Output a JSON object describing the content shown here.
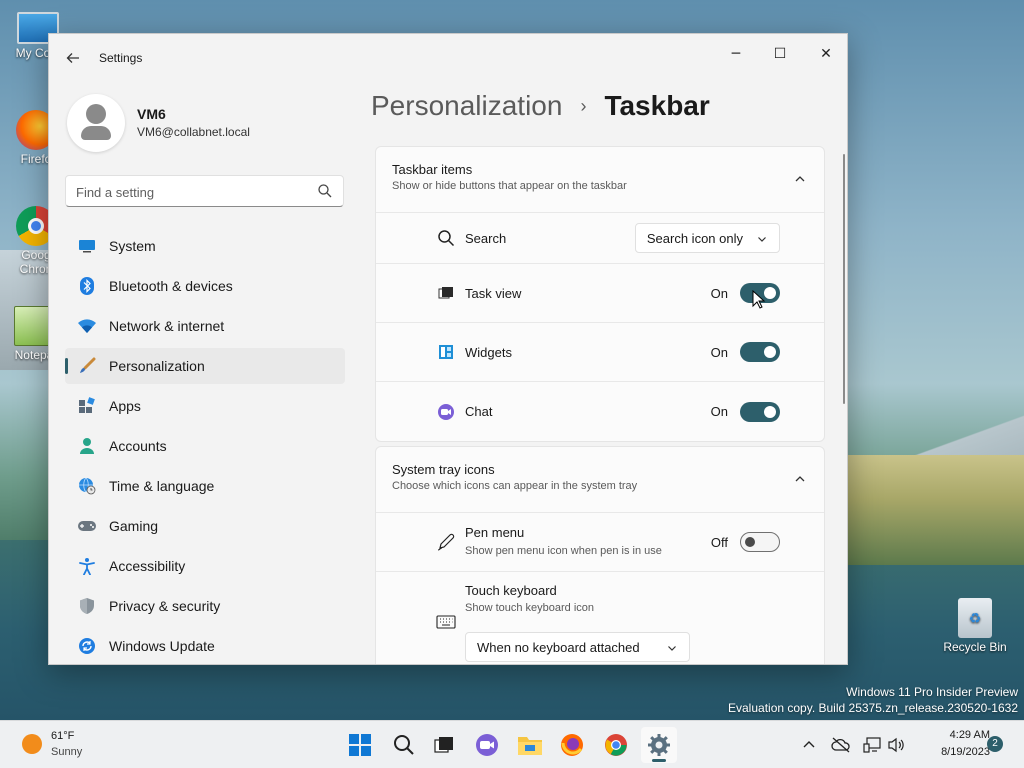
{
  "desktop": {
    "icons": [
      {
        "label": "My Com",
        "name": "my-computer"
      },
      {
        "label": "Firefo",
        "name": "firefox"
      },
      {
        "label": "Goog",
        "label2": "Chron",
        "name": "google-chrome"
      },
      {
        "label": "Notepa",
        "name": "notepad"
      },
      {
        "label": "Recycle Bin",
        "name": "recycle-bin"
      }
    ],
    "watermark_line1": "Windows 11 Pro Insider Preview",
    "watermark_line2": "Evaluation copy. Build 25375.zn_release.230520-1632"
  },
  "window": {
    "title": "Settings",
    "minimize_icon": "─",
    "maximize_icon": "☐",
    "close_icon": "✕"
  },
  "profile": {
    "name": "VM6",
    "email": "VM6@collabnet.local"
  },
  "search": {
    "placeholder": "Find a setting"
  },
  "nav": {
    "items": [
      {
        "label": "System",
        "icon": "monitor-icon"
      },
      {
        "label": "Bluetooth & devices",
        "icon": "bluetooth-icon"
      },
      {
        "label": "Network & internet",
        "icon": "wifi-icon"
      },
      {
        "label": "Personalization",
        "icon": "brush-icon",
        "active": true
      },
      {
        "label": "Apps",
        "icon": "apps-icon"
      },
      {
        "label": "Accounts",
        "icon": "person-icon"
      },
      {
        "label": "Time & language",
        "icon": "globe-clock-icon"
      },
      {
        "label": "Gaming",
        "icon": "gamepad-icon"
      },
      {
        "label": "Accessibility",
        "icon": "accessibility-icon"
      },
      {
        "label": "Privacy & security",
        "icon": "shield-icon"
      },
      {
        "label": "Windows Update",
        "icon": "update-icon"
      }
    ]
  },
  "breadcrumb": {
    "parent": "Personalization",
    "separator": "›",
    "current": "Taskbar"
  },
  "taskbar_items": {
    "title": "Taskbar items",
    "description": "Show or hide buttons that appear on the taskbar",
    "search": {
      "label": "Search",
      "value": "Search icon only"
    },
    "task_view": {
      "label": "Task view",
      "state": "On"
    },
    "widgets": {
      "label": "Widgets",
      "state": "On"
    },
    "chat": {
      "label": "Chat",
      "state": "On"
    }
  },
  "system_tray": {
    "title": "System tray icons",
    "description": "Choose which icons can appear in the system tray",
    "pen_menu": {
      "label": "Pen menu",
      "sublabel": "Show pen menu icon when pen is in use",
      "state": "Off"
    },
    "touch_keyboard": {
      "label": "Touch keyboard",
      "sublabel": "Show touch keyboard icon",
      "value": "When no keyboard attached"
    }
  },
  "taskbar": {
    "weather": {
      "temp": "61°F",
      "condition": "Sunny"
    },
    "clock": {
      "time": "4:29 AM",
      "date": "8/19/2023"
    },
    "notifications": "2",
    "accent": "#2d5f6b"
  }
}
